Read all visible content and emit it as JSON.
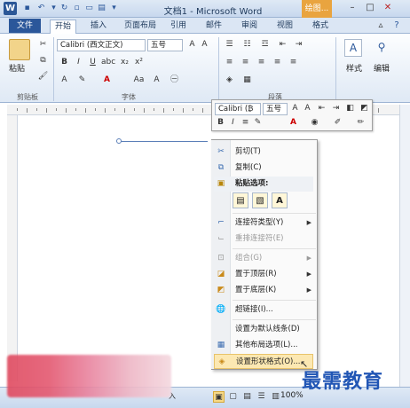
{
  "titlebar": {
    "title": "文档1 - Microsoft Word",
    "context_tab": "绘图...",
    "app_icon": "W"
  },
  "tabs": [
    "文件",
    "开始",
    "插入",
    "页面布局",
    "引用",
    "邮件",
    "审阅",
    "视图",
    "格式"
  ],
  "ribbon": {
    "clipboard": {
      "paste_label": "粘贴",
      "group_label": "剪贴板"
    },
    "font": {
      "name": "Calibri (西文正文)",
      "size": "五号",
      "group_label": "字体"
    },
    "paragraph": {
      "group_label": "段落"
    },
    "styles": {
      "label": "样式"
    },
    "editing": {
      "label": "编辑"
    }
  },
  "mini_toolbar": {
    "font": "Calibri (₿",
    "size": "五号"
  },
  "context_menu": {
    "items": [
      {
        "label": "剪切(T)",
        "icon": "scissors-icon",
        "enabled": true
      },
      {
        "label": "复制(C)",
        "icon": "copy-icon",
        "enabled": true
      },
      {
        "label": "粘贴选项:",
        "icon": "paste-icon",
        "enabled": true
      },
      {
        "label": "连接符类型(Y)",
        "icon": "connector-icon",
        "enabled": true,
        "submenu": true
      },
      {
        "label": "重排连接符(E)",
        "icon": "reroute-icon",
        "enabled": false
      },
      {
        "label": "组合(G)",
        "icon": "group-icon",
        "enabled": false,
        "submenu": true
      },
      {
        "label": "置于顶层(R)",
        "icon": "bring-front-icon",
        "enabled": true,
        "submenu": true
      },
      {
        "label": "置于底层(K)",
        "icon": "send-back-icon",
        "enabled": true,
        "submenu": true
      },
      {
        "label": "超链接(I)...",
        "icon": "hyperlink-icon",
        "enabled": true
      },
      {
        "label": "设置为默认线条(D)",
        "icon": "",
        "enabled": true
      },
      {
        "label": "其他布局选项(L)...",
        "icon": "layout-icon",
        "enabled": true
      },
      {
        "label": "设置形状格式(O)...",
        "icon": "format-shape-icon",
        "enabled": true
      }
    ]
  },
  "statusbar": {
    "zoom": "100%"
  },
  "watermark": "最需教育"
}
